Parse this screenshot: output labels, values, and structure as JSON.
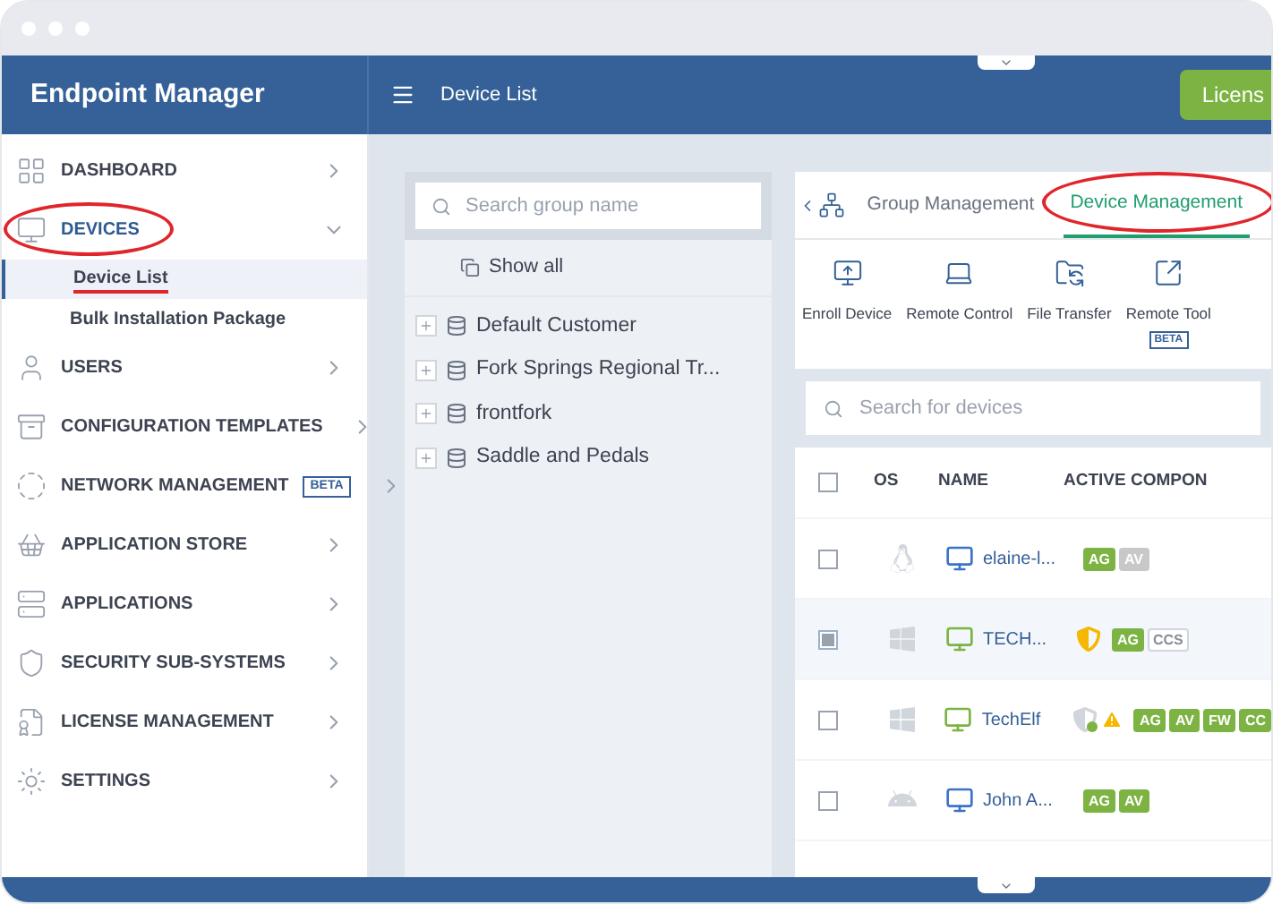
{
  "header": {
    "app_title": "Endpoint Manager",
    "page_title": "Device List",
    "license_button": "Licens"
  },
  "sidebar": {
    "items": [
      {
        "label": "DASHBOARD",
        "expanded": false,
        "circled": false
      },
      {
        "label": "DEVICES",
        "expanded": true,
        "circled": true,
        "children": [
          {
            "label": "Device List",
            "selected": true,
            "underlined": true
          },
          {
            "label": "Bulk Installation Package",
            "selected": false,
            "underlined": false
          }
        ]
      },
      {
        "label": "USERS",
        "expanded": false,
        "circled": false
      },
      {
        "label": "CONFIGURATION TEMPLATES",
        "expanded": false,
        "circled": false
      },
      {
        "label": "NETWORK MANAGEMENT",
        "expanded": false,
        "circled": false,
        "badge": "BETA"
      },
      {
        "label": "APPLICATION STORE",
        "expanded": false,
        "circled": false
      },
      {
        "label": "APPLICATIONS",
        "expanded": false,
        "circled": false
      },
      {
        "label": "SECURITY SUB-SYSTEMS",
        "expanded": false,
        "circled": false
      },
      {
        "label": "LICENSE MANAGEMENT",
        "expanded": false,
        "circled": false
      },
      {
        "label": "SETTINGS",
        "expanded": false,
        "circled": false
      }
    ]
  },
  "groups": {
    "search": {
      "placeholder": "Search group name"
    },
    "show_all": "Show all",
    "items": [
      {
        "label": "Default Customer"
      },
      {
        "label": "Fork Springs Regional Tr..."
      },
      {
        "label": "frontfork"
      },
      {
        "label": "Saddle and Pedals"
      }
    ]
  },
  "devices": {
    "tabs": [
      {
        "label": "Group Management",
        "selected": false,
        "circled": false
      },
      {
        "label": "Device Management",
        "selected": true,
        "circled": true
      }
    ],
    "toolbar": [
      {
        "label": "Enroll Device"
      },
      {
        "label": "Remote Control"
      },
      {
        "label": "File Transfer"
      },
      {
        "label": "Remote Tool",
        "badge": "BETA"
      }
    ],
    "search": {
      "placeholder": "Search for devices"
    },
    "table": {
      "select_all": {
        "checked": false
      },
      "columns": [
        "OS",
        "NAME",
        "ACTIVE COMPON"
      ],
      "rows": [
        {
          "checked": false,
          "selected": false,
          "os": {
            "kind": "linux"
          },
          "color": "#3b73c9",
          "name": "elaine-l...",
          "alerts": [],
          "components": [
            {
              "label": "AG",
              "kind": "on"
            },
            {
              "label": "AV",
              "kind": "off"
            }
          ]
        },
        {
          "checked": true,
          "selected": true,
          "os": {
            "kind": "windows"
          },
          "color": "#7cb342",
          "name": "TECH...",
          "alerts": [
            {
              "kind": "shield"
            }
          ],
          "components": [
            {
              "label": "AG",
              "kind": "on"
            },
            {
              "label": "CCS",
              "kind": "outline"
            }
          ]
        },
        {
          "checked": false,
          "selected": false,
          "os": {
            "kind": "windows"
          },
          "color": "#7cb342",
          "name": "TechElf",
          "alerts": [
            {
              "kind": "shielddot"
            },
            {
              "kind": "warning"
            }
          ],
          "components": [
            {
              "label": "AG",
              "kind": "on"
            },
            {
              "label": "AV",
              "kind": "on"
            },
            {
              "label": "FW",
              "kind": "on"
            },
            {
              "label": "CC",
              "kind": "on"
            }
          ]
        },
        {
          "checked": false,
          "selected": false,
          "os": {
            "kind": "android"
          },
          "color": "#3b73c9",
          "name": "John A...",
          "alerts": [],
          "components": [
            {
              "label": "AG",
              "kind": "on"
            },
            {
              "label": "AV",
              "kind": "on"
            }
          ]
        }
      ]
    }
  }
}
